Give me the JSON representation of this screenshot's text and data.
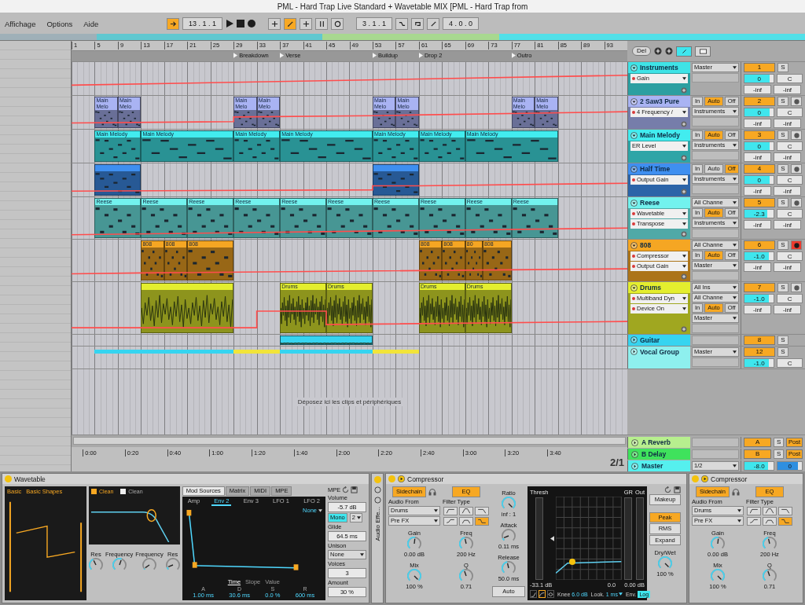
{
  "window": {
    "title": "PML - Hard Trap Live Standard + Wavetable MIX [PML - Hard Trap from"
  },
  "menu": [
    "Affichage",
    "Options",
    "Aide"
  ],
  "transport": {
    "follow": true,
    "position": "13 . 1 . 1",
    "automation_arm": true,
    "loop_start": "3 . 1 . 1",
    "loop_length": "4 . 0 . 0"
  },
  "lane_tools": {
    "delete": "Del"
  },
  "ruler": {
    "bars": [
      "1",
      "5",
      "9",
      "13",
      "17",
      "21",
      "25",
      "29",
      "33",
      "37",
      "41",
      "45",
      "49",
      "53",
      "57",
      "61",
      "65",
      "69",
      "73",
      "77",
      "81",
      "85",
      "89",
      "93"
    ],
    "locators": [
      {
        "label": "Breakdown"
      },
      {
        "label": "Verse"
      },
      {
        "label": "Buildup"
      },
      {
        "label": "Drop 2"
      },
      {
        "label": "Outro"
      }
    ]
  },
  "tracks": [
    {
      "name": "Instruments",
      "color": "#3fe3e6",
      "expanded": true,
      "params": [
        {
          "label": "Gain",
          "automated": true
        }
      ],
      "routing": [
        {
          "kind": "dropdown",
          "value": "Master"
        },
        {
          "kind": "slot"
        }
      ],
      "active": true,
      "number": "1",
      "solo": "S",
      "volume": "0",
      "level": 0.85,
      "pan": "C",
      "sends": [
        "-inf",
        "-inf"
      ]
    },
    {
      "name": "2 Saw3 Pure",
      "color": "#a9b3f3",
      "expanded": true,
      "params": [
        {
          "label": "4 Frequency /",
          "automated": true
        }
      ],
      "routing": [
        {
          "kind": "monitor",
          "options": [
            {
              "label": "In",
              "selected": false
            },
            {
              "label": "Auto",
              "selected": true
            },
            {
              "label": "Off",
              "selected": false
            }
          ]
        },
        {
          "kind": "dropdown",
          "value": "Instruments"
        },
        {
          "kind": "slot"
        }
      ],
      "active": true,
      "number": "2",
      "solo": "S",
      "armed": false,
      "volume": "0",
      "level": 0.85,
      "pan": "C",
      "sends": [
        "-inf",
        "-inf"
      ],
      "clips": [
        {
          "name": "Main Melo",
          "kind": "midi"
        },
        {
          "name": "Main Melo",
          "kind": "midi"
        },
        {
          "name": "Main Melo",
          "kind": "midi"
        },
        {
          "name": "Main Melo",
          "kind": "midi"
        },
        {
          "name": "Main Melo",
          "kind": "midi"
        },
        {
          "name": "Main Melo",
          "kind": "midi"
        },
        {
          "name": "Main Melo",
          "kind": "midi"
        },
        {
          "name": "Main Melo",
          "kind": "midi"
        }
      ]
    },
    {
      "name": "Main Melody",
      "color": "#42ecef",
      "expanded": true,
      "params": [
        {
          "label": "ER Level",
          "automated": false
        }
      ],
      "routing": [
        {
          "kind": "monitor",
          "options": [
            {
              "label": "In",
              "selected": false
            },
            {
              "label": "Auto",
              "selected": true
            },
            {
              "label": "Off",
              "selected": false
            }
          ]
        },
        {
          "kind": "dropdown",
          "value": "Instruments"
        },
        {
          "kind": "slot"
        }
      ],
      "active": true,
      "number": "3",
      "solo": "S",
      "armed": false,
      "volume": "0",
      "level": 0.85,
      "pan": "C",
      "sends": [
        "-inf",
        "-inf"
      ],
      "clips": [
        {
          "name": "Main Melody",
          "kind": "midi"
        },
        {
          "name": "Main Melody",
          "kind": "midi"
        },
        {
          "name": "Main Melody",
          "kind": "midi"
        },
        {
          "name": "Main Melody",
          "kind": "midi"
        },
        {
          "name": "Main Melody",
          "kind": "midi"
        },
        {
          "name": "Main Melody",
          "kind": "midi"
        },
        {
          "name": "Main Melody",
          "kind": "midi"
        }
      ]
    },
    {
      "name": "Half Time",
      "color": "#3f8ff0",
      "expanded": true,
      "params": [
        {
          "label": "Output Gain",
          "automated": true
        }
      ],
      "routing": [
        {
          "kind": "monitor",
          "options": [
            {
              "label": "In",
              "selected": false
            },
            {
              "label": "Auto",
              "selected": false
            },
            {
              "label": "Off",
              "selected": true
            }
          ]
        },
        {
          "kind": "dropdown",
          "value": "Instruments"
        },
        {
          "kind": "slot"
        }
      ],
      "active": true,
      "number": "4",
      "solo": "S",
      "armed": false,
      "volume": "0",
      "level": 0.85,
      "pan": "C",
      "sends": [
        "-inf",
        "-inf"
      ],
      "clips": [
        {
          "kind": "midi"
        },
        {
          "kind": "midi"
        }
      ]
    },
    {
      "name": "Reese",
      "color": "#72f2ee",
      "expanded": true,
      "params": [
        {
          "label": "Wavetable",
          "automated": true
        },
        {
          "label": "Transpose",
          "automated": true
        }
      ],
      "routing": [
        {
          "kind": "dropdown",
          "value": "All Channe"
        },
        {
          "kind": "monitor",
          "options": [
            {
              "label": "In",
              "selected": false
            },
            {
              "label": "Auto",
              "selected": true
            },
            {
              "label": "Off",
              "selected": false
            }
          ]
        },
        {
          "kind": "dropdown",
          "value": "Instruments"
        },
        {
          "kind": "slot"
        }
      ],
      "active": true,
      "number": "5",
      "solo": "S",
      "armed": false,
      "volume": "-2.3",
      "level": 0.78,
      "pan": "C",
      "sends": [
        "-inf",
        "-inf"
      ],
      "clips": [
        {
          "name": "Reese",
          "kind": "midi"
        },
        {
          "name": "Reese",
          "kind": "midi"
        },
        {
          "name": "Reese",
          "kind": "midi"
        },
        {
          "name": "Reese",
          "kind": "midi"
        },
        {
          "name": "Reese",
          "kind": "midi"
        },
        {
          "name": "Reese",
          "kind": "midi"
        },
        {
          "name": "Reese",
          "kind": "midi"
        },
        {
          "name": "Reese",
          "kind": "midi"
        },
        {
          "name": "Reese",
          "kind": "midi"
        },
        {
          "name": "Reese",
          "kind": "midi"
        }
      ]
    },
    {
      "name": "808",
      "color": "#f5a623",
      "expanded": true,
      "params": [
        {
          "label": "Compressor",
          "automated": true
        },
        {
          "label": "Output Gain",
          "automated": true
        }
      ],
      "routing": [
        {
          "kind": "dropdown",
          "value": "All Channe"
        },
        {
          "kind": "monitor",
          "options": [
            {
              "label": "In",
              "selected": false
            },
            {
              "label": "Auto",
              "selected": true
            },
            {
              "label": "Off",
              "selected": false
            }
          ]
        },
        {
          "kind": "dropdown",
          "value": "Master"
        },
        {
          "kind": "slot"
        }
      ],
      "active": true,
      "number": "6",
      "solo": "S",
      "armed": true,
      "volume": "-1.0",
      "level": 0.82,
      "pan": "C",
      "sends": [
        "-inf",
        "-inf"
      ],
      "clips": [
        {
          "name": "808",
          "kind": "midi"
        },
        {
          "name": "808",
          "kind": "midi"
        },
        {
          "name": "808",
          "kind": "midi"
        },
        {
          "name": "808",
          "kind": "midi"
        },
        {
          "name": "808",
          "kind": "midi"
        },
        {
          "name": "80",
          "kind": "midi"
        },
        {
          "name": "808",
          "kind": "midi"
        }
      ]
    },
    {
      "name": "Drums",
      "color": "#e4ee2e",
      "expanded": true,
      "params": [
        {
          "label": "Multiband Dyn",
          "automated": true
        },
        {
          "label": "Device On",
          "automated": true
        }
      ],
      "routing": [
        {
          "kind": "dropdown",
          "value": "All Ins"
        },
        {
          "kind": "dropdown",
          "value": "All Channe"
        },
        {
          "kind": "monitor",
          "options": [
            {
              "label": "In",
              "selected": false
            },
            {
              "label": "Auto",
              "selected": true
            },
            {
              "label": "Off",
              "selected": false
            }
          ]
        },
        {
          "kind": "dropdown",
          "value": "Master"
        },
        {
          "kind": "slot"
        }
      ],
      "active": true,
      "number": "7",
      "solo": "S",
      "armed": false,
      "volume": "-1.0",
      "level": 0.82,
      "pan": "C",
      "sends": [
        "-inf",
        "-inf"
      ],
      "clips": [
        {
          "kind": "audio"
        },
        {
          "name": "Drums",
          "kind": "audio"
        },
        {
          "name": "Drums",
          "kind": "audio"
        },
        {
          "name": "Drums",
          "kind": "audio"
        },
        {
          "name": "Drums",
          "kind": "audio"
        }
      ]
    },
    {
      "name": "Guitar",
      "color": "#36d4f0",
      "expanded": false,
      "routing": [
        {
          "kind": "slot"
        }
      ],
      "active": true,
      "number": "8",
      "solo": "S",
      "clips": [
        {
          "kind": "audio"
        }
      ]
    },
    {
      "name": "Vocal Group",
      "color": "#8ef0ee",
      "expanded": false,
      "routing": [
        {
          "kind": "dropdown",
          "value": "Master"
        },
        {
          "kind": "slot"
        }
      ],
      "active": true,
      "number": "12",
      "solo": "S",
      "volume": "-1.0",
      "level": 0.82,
      "pan": "C",
      "clips": [
        {
          "kind": "overview",
          "color": "#36d4f0"
        },
        {
          "kind": "overview",
          "color": "#f2e43a"
        },
        {
          "kind": "overview",
          "color": "#36d4f0"
        },
        {
          "kind": "overview",
          "color": "#f2e43a"
        }
      ]
    }
  ],
  "drop_hint": "Déposez ici les clips et périphériques",
  "time_ruler": {
    "labels": [
      "0:00",
      "0:20",
      "0:40",
      "1:00",
      "1:20",
      "1:40",
      "2:00",
      "2:20",
      "2:40",
      "3:00",
      "3:20",
      "3:40"
    ],
    "grid": "2/1"
  },
  "returns": [
    {
      "name": "A Reverb",
      "color": "#b7ef8e",
      "active": true,
      "number": "A",
      "solo": "S",
      "output": "Post"
    },
    {
      "name": "B Delay",
      "color": "#3fe25c",
      "active": true,
      "number": "B",
      "solo": "S",
      "output": "Post"
    }
  ],
  "master": {
    "name": "Master",
    "color": "#55f0ee",
    "output": "1/2",
    "volume": "-8.0",
    "level": 0.8,
    "cue": {
      "value": "0",
      "level": 0.85
    }
  },
  "devices": {
    "wavetable": {
      "title": "Wavetable",
      "on": true,
      "osc": {
        "category": "Basic",
        "table": "Basic Shapes"
      },
      "filters": [
        {
          "on": true,
          "type": "Clean"
        },
        {
          "on": false,
          "type": "Clean"
        }
      ],
      "filter_knobs": [
        {
          "label": "Res",
          "level": 0.25
        },
        {
          "label": "Frequency",
          "level": 0.6
        },
        {
          "label": "Frequency",
          "level": 0.05
        },
        {
          "label": "Res",
          "level": 0.1
        }
      ],
      "mod_tabs": [
        {
          "label": "Mod Sources",
          "selected": true
        },
        {
          "label": "Matrix",
          "selected": false
        },
        {
          "label": "MIDI",
          "selected": false
        },
        {
          "label": "MPE",
          "selected": false
        }
      ],
      "env_tabs": [
        {
          "label": "Amp",
          "selected": false
        },
        {
          "label": "Env 2",
          "selected": true
        },
        {
          "label": "Env 3",
          "selected": false
        },
        {
          "label": "LFO 1",
          "selected": false
        },
        {
          "label": "LFO 2",
          "selected": false
        }
      ],
      "mod_target": "None",
      "view_tabs": [
        {
          "label": "Time",
          "selected": true
        },
        {
          "label": "Slope",
          "selected": false
        },
        {
          "label": "Value",
          "selected": false
        }
      ],
      "envelope": [
        {
          "label": "A",
          "value": "1.00 ms"
        },
        {
          "label": "D",
          "value": "30.6 ms"
        },
        {
          "label": "S",
          "value": "0.0 %"
        },
        {
          "label": "R",
          "value": "600 ms"
        }
      ],
      "mpe": "MPE",
      "global": [
        {
          "kind": "field",
          "label": "Volume",
          "value": "-5.7 dB"
        },
        {
          "kind": "toggle",
          "label": "Mono",
          "selected": true,
          "value": "2"
        },
        {
          "kind": "field",
          "label": "Glide",
          "value": "64.5 ms"
        },
        {
          "kind": "dropdown",
          "label": "Unison",
          "value": "None"
        },
        {
          "kind": "field",
          "label": "Voices",
          "value": "3"
        },
        {
          "kind": "field",
          "label": "Amount",
          "value": "30 %"
        }
      ]
    },
    "rack": {
      "title": "Audio Effe..."
    },
    "compressors": [
      {
        "title": "Compressor",
        "on": true,
        "sidechain": {
          "label": "Sidechain",
          "selected": true
        },
        "eq": {
          "label": "EQ",
          "selected": true
        },
        "audio_from_label": "Audio From",
        "audio_from": "Drums",
        "position": "Pre FX",
        "knobs_left": [
          {
            "label": "Gain",
            "value": "0.00 dB",
            "level": 0.5
          },
          {
            "label": "Mix",
            "value": "100 %",
            "level": 1
          }
        ],
        "filter_label": "Filter Type",
        "filter_types": [
          {
            "selected": false
          },
          {
            "selected": false
          },
          {
            "selected": false
          },
          {
            "selected": false
          },
          {
            "selected": false
          },
          {
            "selected": true
          }
        ],
        "knobs_eq": [
          {
            "label": "Freq",
            "value": "200 Hz",
            "level": 0.35
          },
          {
            "label": "Q",
            "value": "0.71",
            "level": 0.3
          }
        ],
        "knobs_dyn": [
          {
            "label": "Ratio",
            "value": "inf : 1",
            "level": 1
          },
          {
            "label": "Attack",
            "value": "0.11 ms",
            "level": 0.1
          },
          {
            "label": "Release",
            "value": "50.0 ms",
            "level": 0.35
          }
        ],
        "auto": {
          "label": "Auto",
          "selected": false
        },
        "display": {
          "thresh_label": "Thresh",
          "thresh": "-33.1 dB",
          "gr_label": "GR",
          "gr": "0.0",
          "out_label": "Out",
          "out": "0.00 dB",
          "modes": [
            {
              "selected": false
            },
            {
              "selected": true
            },
            {
              "selected": false
            }
          ],
          "knee_label": "Knee",
          "knee": "6.0 dB",
          "look_label": "Look.",
          "look": "1 ms",
          "env_label": "Env.",
          "env": "Log"
        },
        "makeup": {
          "label": "Makeup",
          "selected": false
        },
        "detection": [
          {
            "label": "Peak",
            "selected": true
          },
          {
            "label": "RMS",
            "selected": false
          },
          {
            "label": "Expand",
            "selected": false
          }
        ],
        "drywet": {
          "label": "Dry/Wet",
          "value": "100 %",
          "level": 1
        }
      },
      {
        "title": "Compressor",
        "on": true,
        "sidechain": {
          "label": "Sidechain",
          "selected": true
        },
        "eq": {
          "label": "EQ",
          "selected": true
        },
        "audio_from_label": "Audio From",
        "audio_from": "Drums",
        "position": "Pre FX",
        "knobs_left": [
          {
            "label": "Gain",
            "value": "0.00 dB",
            "level": 0.5
          },
          {
            "label": "Mix",
            "value": "100 %",
            "level": 1
          }
        ],
        "filter_label": "Filter Type",
        "filter_types": [
          {
            "selected": false
          },
          {
            "selected": false
          },
          {
            "selected": false
          },
          {
            "selected": false
          },
          {
            "selected": false
          },
          {
            "selected": true
          }
        ],
        "knobs_eq": [
          {
            "label": "Freq",
            "value": "200 Hz",
            "level": 0.35
          },
          {
            "label": "Q",
            "value": "0.71",
            "level": 0.3
          }
        ]
      }
    ]
  }
}
